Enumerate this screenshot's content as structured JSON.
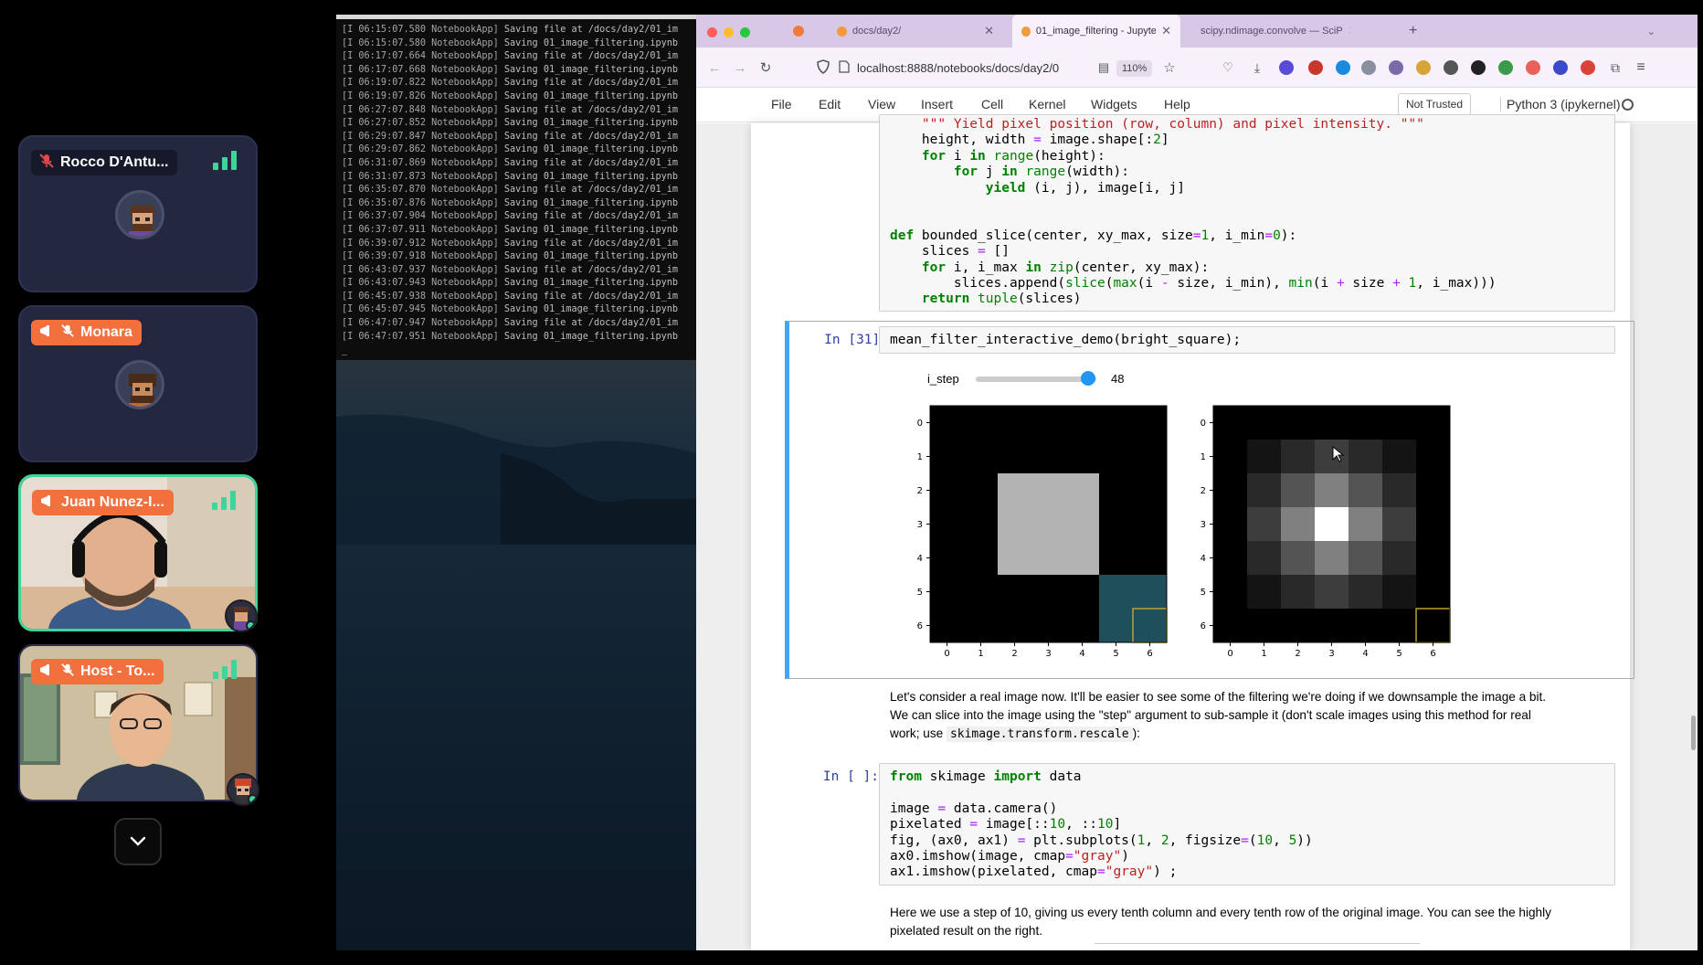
{
  "participants": [
    {
      "name": "Rocco D'Antu...",
      "muted": true,
      "pill": "dark",
      "type": "avatar"
    },
    {
      "name": "Monara",
      "muted": true,
      "pill": "orange",
      "type": "avatar"
    },
    {
      "name": "Juan Nunez-I...",
      "muted": false,
      "pill": "orange",
      "type": "video"
    },
    {
      "name": "Host - To...",
      "muted": true,
      "pill": "orange",
      "type": "video"
    }
  ],
  "terminal": {
    "lines": [
      {
        "ts": "[I 06:15:07.580 NotebookApp]",
        "msg": "Saving file at /docs/day2/01_im"
      },
      {
        "ts": "[I 06:15:07.580 NotebookApp]",
        "msg": "Saving 01_image_filtering.ipynb"
      },
      {
        "ts": "[I 06:17:07.664 NotebookApp]",
        "msg": "Saving file at /docs/day2/01_im"
      },
      {
        "ts": "[I 06:17:07.668 NotebookApp]",
        "msg": "Saving 01_image_filtering.ipynb"
      },
      {
        "ts": "[I 06:19:07.822 NotebookApp]",
        "msg": "Saving file at /docs/day2/01_im"
      },
      {
        "ts": "[I 06:19:07.826 NotebookApp]",
        "msg": "Saving 01_image_filtering.ipynb"
      },
      {
        "ts": "[I 06:27:07.848 NotebookApp]",
        "msg": "Saving file at /docs/day2/01_im"
      },
      {
        "ts": "[I 06:27:07.852 NotebookApp]",
        "msg": "Saving 01_image_filtering.ipynb"
      },
      {
        "ts": "[I 06:29:07.847 NotebookApp]",
        "msg": "Saving file at /docs/day2/01_im"
      },
      {
        "ts": "[I 06:29:07.862 NotebookApp]",
        "msg": "Saving 01_image_filtering.ipynb"
      },
      {
        "ts": "[I 06:31:07.869 NotebookApp]",
        "msg": "Saving file at /docs/day2/01_im"
      },
      {
        "ts": "[I 06:31:07.873 NotebookApp]",
        "msg": "Saving 01_image_filtering.ipynb"
      },
      {
        "ts": "[I 06:35:07.870 NotebookApp]",
        "msg": "Saving file at /docs/day2/01_im"
      },
      {
        "ts": "[I 06:35:07.876 NotebookApp]",
        "msg": "Saving 01_image_filtering.ipynb"
      },
      {
        "ts": "[I 06:37:07.904 NotebookApp]",
        "msg": "Saving file at /docs/day2/01_im"
      },
      {
        "ts": "[I 06:37:07.911 NotebookApp]",
        "msg": "Saving 01_image_filtering.ipynb"
      },
      {
        "ts": "[I 06:39:07.912 NotebookApp]",
        "msg": "Saving file at /docs/day2/01_im"
      },
      {
        "ts": "[I 06:39:07.918 NotebookApp]",
        "msg": "Saving 01_image_filtering.ipynb"
      },
      {
        "ts": "[I 06:43:07.937 NotebookApp]",
        "msg": "Saving file at /docs/day2/01_im"
      },
      {
        "ts": "[I 06:43:07.943 NotebookApp]",
        "msg": "Saving 01_image_filtering.ipynb"
      },
      {
        "ts": "[I 06:45:07.938 NotebookApp]",
        "msg": "Saving file at /docs/day2/01_im"
      },
      {
        "ts": "[I 06:45:07.945 NotebookApp]",
        "msg": "Saving 01_image_filtering.ipynb"
      },
      {
        "ts": "[I 06:47:07.947 NotebookApp]",
        "msg": "Saving file at /docs/day2/01_im"
      },
      {
        "ts": "[I 06:47:07.951 NotebookApp]",
        "msg": "Saving 01_image_filtering.ipynb"
      }
    ],
    "cursor": "_"
  },
  "browser": {
    "tabs": [
      {
        "label": "docs/day2/",
        "active": false
      },
      {
        "label": "01_image_filtering - Jupyter N",
        "active": true
      },
      {
        "label": "scipy.ndimage.convolve — SciP",
        "active": false
      }
    ],
    "new_tab": "+",
    "url": "localhost:8888/notebooks/docs/day2/0",
    "zoom": "110%"
  },
  "jupyter": {
    "menu": [
      "File",
      "Edit",
      "View",
      "Insert",
      "Cell",
      "Kernel",
      "Widgets",
      "Help"
    ],
    "trust": "Not Trusted",
    "kernel": "Python 3 (ipykernel)"
  },
  "cells": {
    "prev_code": [
      "    \"\"\" Yield pixel position (row, column) and pixel intensity. \"\"\"",
      "    height, width = image.shape[:2]",
      "    for i in range(height):",
      "        for j in range(width):",
      "            yield (i, j), image[i, j]",
      "",
      "",
      "def bounded_slice(center, xy_max, size=1, i_min=0):",
      "    slices = []",
      "    for i, i_max in zip(center, xy_max):",
      "        slices.append(slice(max(i - size, i_min), min(i + size + 1, i_max)))",
      "    return tuple(slices)"
    ],
    "cell31_prompt": "In [31]:",
    "cell31_code": "mean_filter_interactive_demo(bright_square);",
    "slider_label": "i_step",
    "slider_value": "48",
    "slider_fraction": 0.93,
    "md1_line1": "Let's consider a real image now. It'll be easier to see some of the filtering we're doing if we downsample the image a bit.",
    "md1_line2": "We can slice into the image using the \"step\" argument to sub-sample it (don't scale images using this method for real",
    "md1_line3a": "work; use ",
    "md1_code": "skimage.transform.rescale",
    "md1_line3b": "):",
    "cell_next_prompt": "In [ ]:",
    "next_code": [
      "from skimage import data",
      "",
      "image = data.camera()",
      "pixelated = image[::10, ::10]",
      "fig, (ax0, ax1) = plt.subplots(1, 2, figsize=(10, 5))",
      "ax0.imshow(image, cmap=\"gray\")",
      "ax1.imshow(pixelated, cmap=\"gray\") ;"
    ],
    "md2_line1": "Here we use a step of 10, giving us every tenth column and every tenth row of the original image. You can see the highly",
    "md2_line2": "pixelated result on the right."
  },
  "chart_data": [
    {
      "type": "heatmap",
      "x_ticks": [
        "0",
        "1",
        "2",
        "3",
        "4",
        "5",
        "6"
      ],
      "y_ticks": [
        "0",
        "1",
        "2",
        "3",
        "4",
        "5",
        "6"
      ],
      "values": [
        [
          0,
          0,
          0,
          0,
          0,
          0,
          0
        ],
        [
          0,
          0,
          0,
          0,
          0,
          0,
          0
        ],
        [
          0,
          0,
          0.7,
          0.7,
          0.7,
          0,
          0
        ],
        [
          0,
          0,
          0.7,
          0.7,
          0.7,
          0,
          0
        ],
        [
          0,
          0,
          0.7,
          0.7,
          0.7,
          0,
          0
        ],
        [
          0,
          0,
          0,
          0,
          0,
          0,
          0
        ],
        [
          0,
          0,
          0,
          0,
          0,
          0,
          0
        ]
      ],
      "highlight_rect": {
        "x": [
          5,
          6
        ],
        "y": [
          5,
          6
        ],
        "color": "#1f4f5a"
      }
    },
    {
      "type": "heatmap",
      "x_ticks": [
        "0",
        "1",
        "2",
        "3",
        "4",
        "5",
        "6"
      ],
      "y_ticks": [
        "0",
        "1",
        "2",
        "3",
        "4",
        "5",
        "6"
      ],
      "values": [
        [
          0,
          0,
          0,
          0,
          0,
          0,
          0
        ],
        [
          0,
          0.08,
          0.16,
          0.24,
          0.16,
          0.08,
          0
        ],
        [
          0,
          0.16,
          0.33,
          0.5,
          0.33,
          0.16,
          0
        ],
        [
          0,
          0.24,
          0.5,
          1.0,
          0.5,
          0.24,
          0
        ],
        [
          0,
          0.16,
          0.33,
          0.5,
          0.33,
          0.16,
          0
        ],
        [
          0,
          0.08,
          0.16,
          0.24,
          0.16,
          0.08,
          0
        ],
        [
          0,
          0,
          0,
          0,
          0,
          0,
          0
        ]
      ],
      "highlight_rect": {
        "x": [
          6,
          6
        ],
        "y": [
          6,
          6
        ],
        "color": "#b9a132"
      }
    }
  ]
}
